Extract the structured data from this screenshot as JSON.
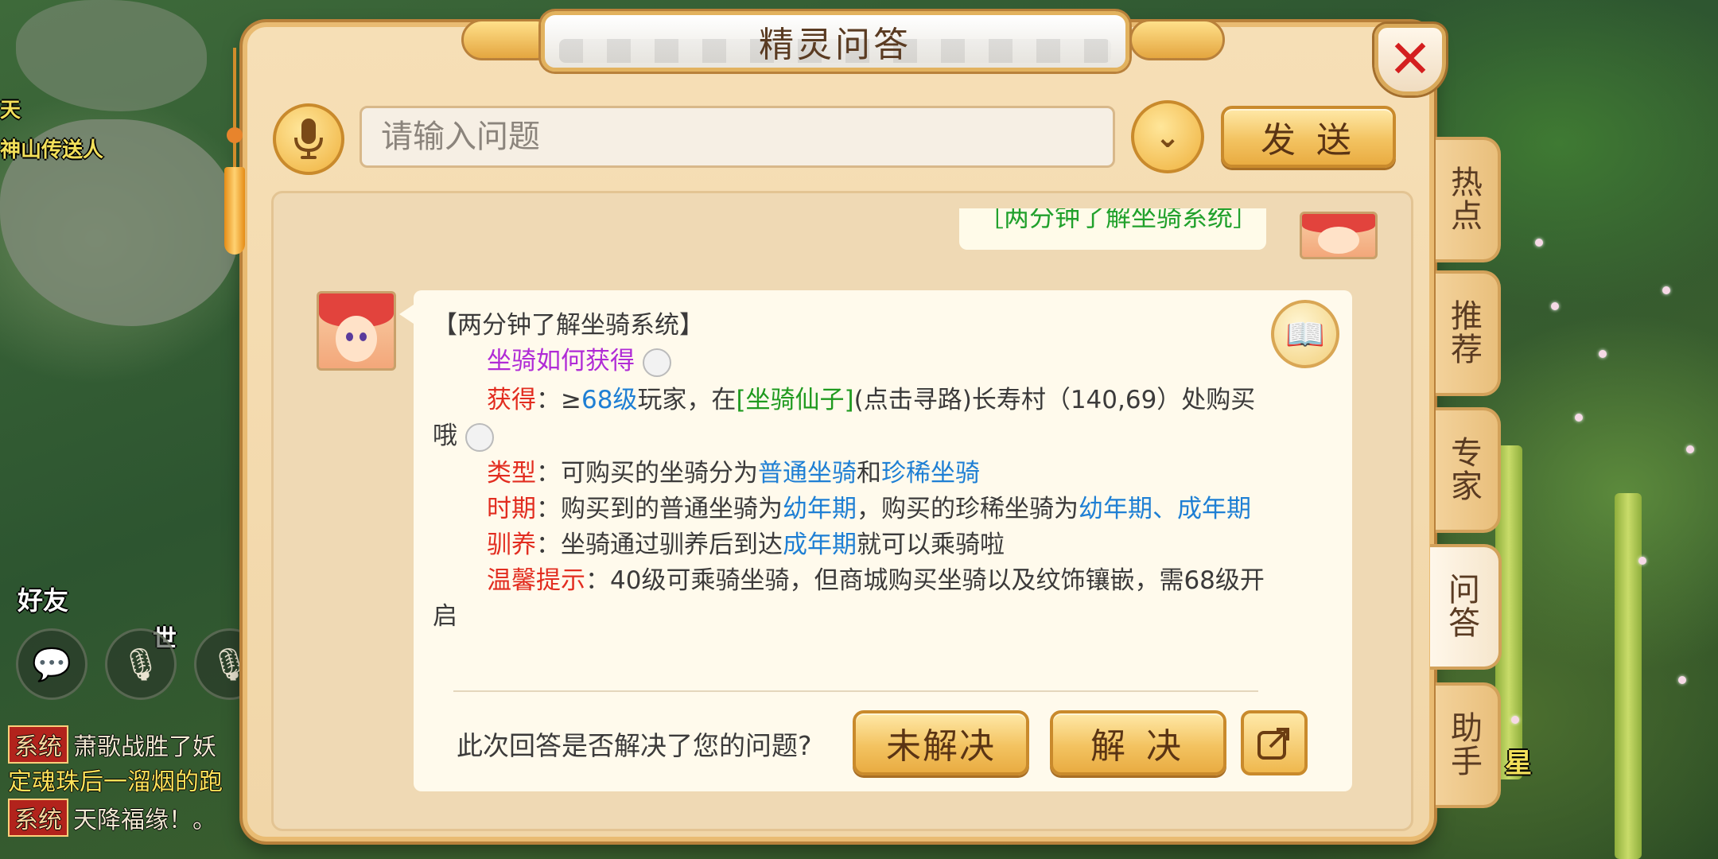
{
  "dialog": {
    "title": "精灵问答",
    "close_label": "✕",
    "input_placeholder": "请输入问题",
    "send_label": "发 送",
    "dropdown_glyph": "⌄"
  },
  "side_tabs": [
    {
      "label": "热\n点",
      "active": false
    },
    {
      "label": "推\n荐",
      "active": false
    },
    {
      "label": "专\n家",
      "active": false
    },
    {
      "label": "问\n答",
      "active": true
    },
    {
      "label": "助\n手",
      "active": false
    }
  ],
  "user_message": "［两分钟了解坐骑系统］",
  "answer": {
    "title": "【两分钟了解坐骑系统】",
    "subtitle": "坐骑如何获得",
    "obtain_label": "获得",
    "obtain_a": "：≥",
    "obtain_level": "68级",
    "obtain_b": "玩家，在",
    "obtain_npc": "[坐骑仙子]",
    "obtain_c": "(点击寻路)长寿村（140,69）处购买",
    "obtain_d": "哦",
    "type_label": "类型",
    "type_a": "：可购买的坐骑分为",
    "type_normal": "普通坐骑",
    "type_and": "和",
    "type_rare": "珍稀坐骑",
    "period_label": "时期",
    "period_a": "：购买到的普通坐骑为",
    "period_young": "幼年期",
    "period_b": "，购买的珍稀坐骑为",
    "period_both": "幼年期、成年期",
    "train_label": "驯养",
    "train_a": "：坐骑通过驯养后到达",
    "train_adult": "成年期",
    "train_b": "就可以乘骑啦",
    "tip_label": "温馨提示",
    "tip_text": "：40级可乘骑坐骑，但商城购买坐骑以及纹饰镶嵌，需68级开",
    "tip_text_2": "启"
  },
  "feedback": {
    "question": "此次回答是否解决了您的问题?",
    "unsolved_label": "未解决",
    "solved_label": "解 决"
  },
  "background": {
    "npc_label_1": "神山传送人",
    "npc_label_2": "天",
    "npc_label_3": "好友",
    "npc_label_4": "世",
    "npc_label_5": "星",
    "chat": [
      {
        "tag": "系统",
        "text": "萧歌战胜了妖"
      },
      {
        "tag": "",
        "text": "定魂珠后一溜烟的跑"
      },
      {
        "tag": "系统",
        "text": "天降福缘！。"
      }
    ]
  },
  "colors": {
    "accent_gold": "#efb13d",
    "highlight_red": "#e22d20",
    "highlight_blue": "#1e7fd4",
    "highlight_green": "#1f9a1f",
    "highlight_purple": "#b02bd6",
    "close_red": "#d41f1f"
  },
  "icons": [
    "mic-icon",
    "chevron-down-icon",
    "close-icon",
    "book-icon",
    "share-icon",
    "chat-icon"
  ]
}
